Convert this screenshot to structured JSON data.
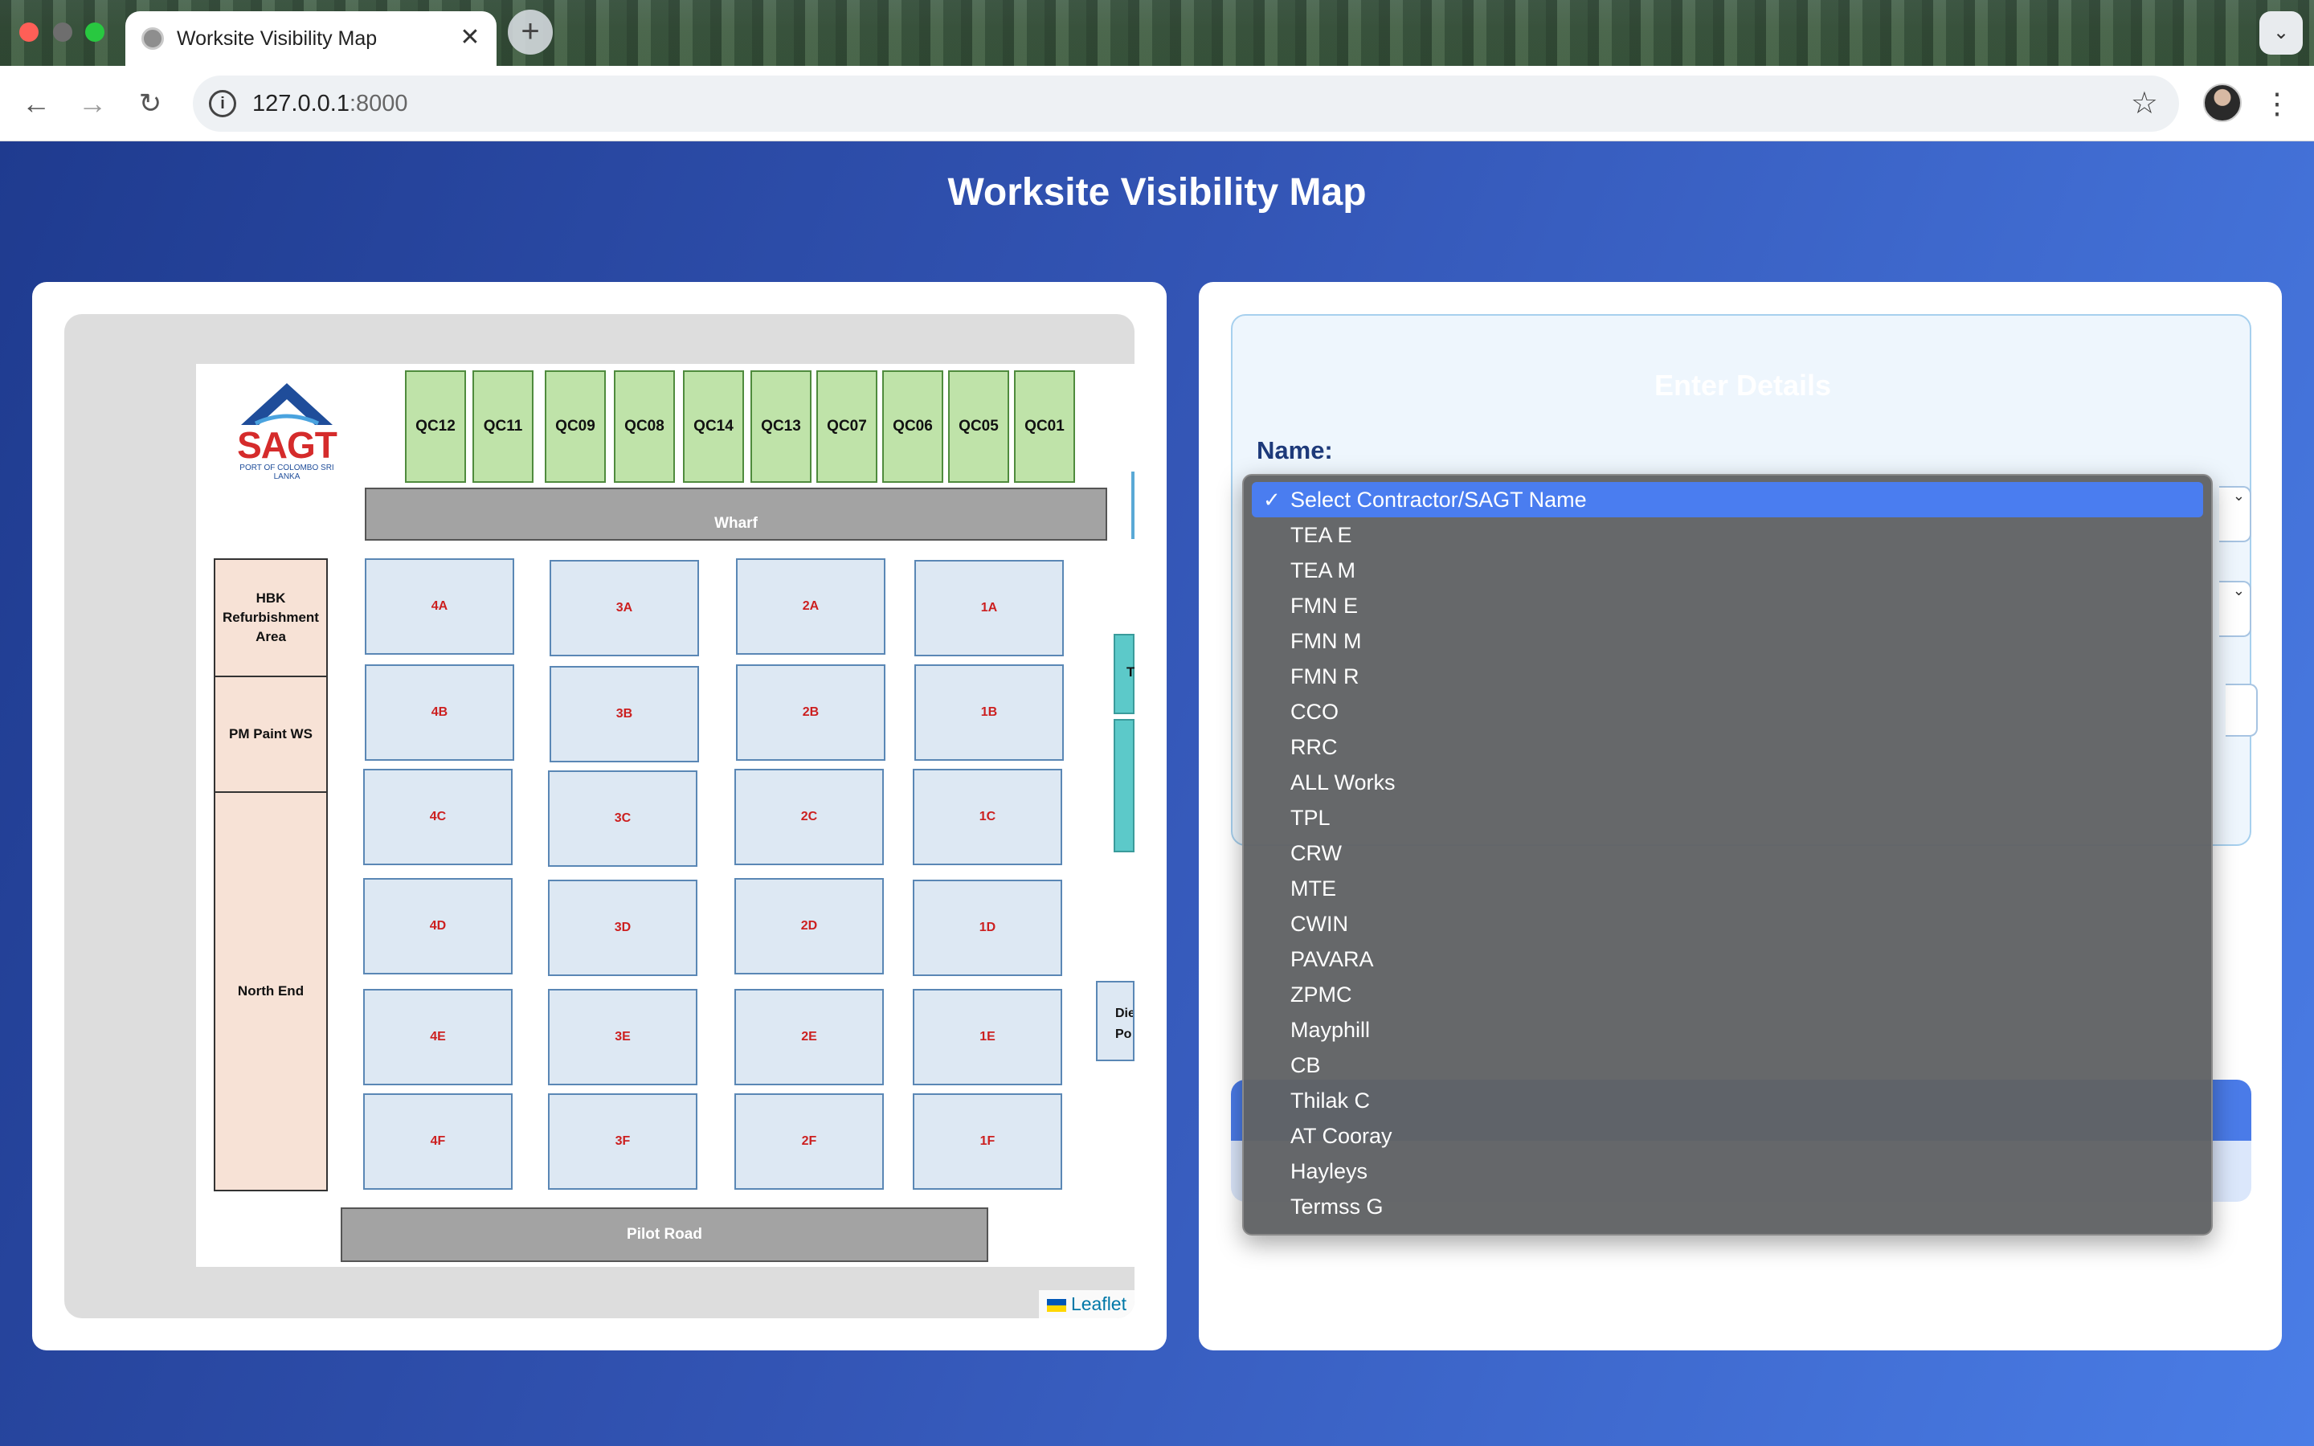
{
  "browser": {
    "tab_title": "Worksite Visibility Map",
    "tab_close": "✕",
    "new_tab": "+",
    "tab_list": "⌄",
    "url_host": "127.0.0.1",
    "url_port": ":8000",
    "nav": {
      "back": "←",
      "forward": "→",
      "reload": "↻"
    },
    "star": "☆",
    "menu": "⋮"
  },
  "page": {
    "title": "Worksite Visibility Map"
  },
  "map": {
    "logo_text": "SAGT",
    "logo_subtitle": "PORT OF COLOMBO SRI LANKA",
    "quay_cranes": [
      "QC12",
      "QC11",
      "QC09",
      "QC08",
      "QC14",
      "QC13",
      "QC07",
      "QC06",
      "QC05",
      "QC01"
    ],
    "wharf": "Wharf",
    "pilot_road": "Pilot Road",
    "zones": {
      "hbk": "HBK Refurbishment Area",
      "pm_paint": "PM Paint WS",
      "north_end": "North End"
    },
    "blocks": {
      "col4": [
        "4A",
        "4B",
        "4C",
        "4D",
        "4E",
        "4F"
      ],
      "col3": [
        "3A",
        "3B",
        "3C",
        "3D",
        "3E",
        "3F"
      ],
      "col2": [
        "2A",
        "2B",
        "2C",
        "2D",
        "2E",
        "2F"
      ],
      "col1": [
        "1A",
        "1B",
        "1C",
        "1D",
        "1E",
        "1F"
      ]
    },
    "teal_label": "T",
    "diesel_label_1": "Die",
    "diesel_label_2": "Po",
    "attribution": "Leaflet"
  },
  "form": {
    "heading": "Enter Details",
    "name_label": "Name:",
    "name_select": {
      "selected": "Select Contractor/SAGT Name",
      "options": [
        "TEA E",
        "TEA M",
        "FMN E",
        "FMN M",
        "FMN R",
        "CCO",
        "RRC",
        "ALL Works",
        "TPL",
        "CRW",
        "MTE",
        "CWIN",
        "PAVARA",
        "ZPMC",
        "Mayphill",
        "CB",
        "Thilak C",
        "AT Cooray",
        "Hayleys",
        "Termss G"
      ]
    }
  },
  "colors": {
    "page_gradient_start": "#1f3b8f",
    "page_gradient_end": "#4a7de6",
    "dropdown_highlight": "#4a7df0",
    "block_label": "#cc1f1f"
  }
}
